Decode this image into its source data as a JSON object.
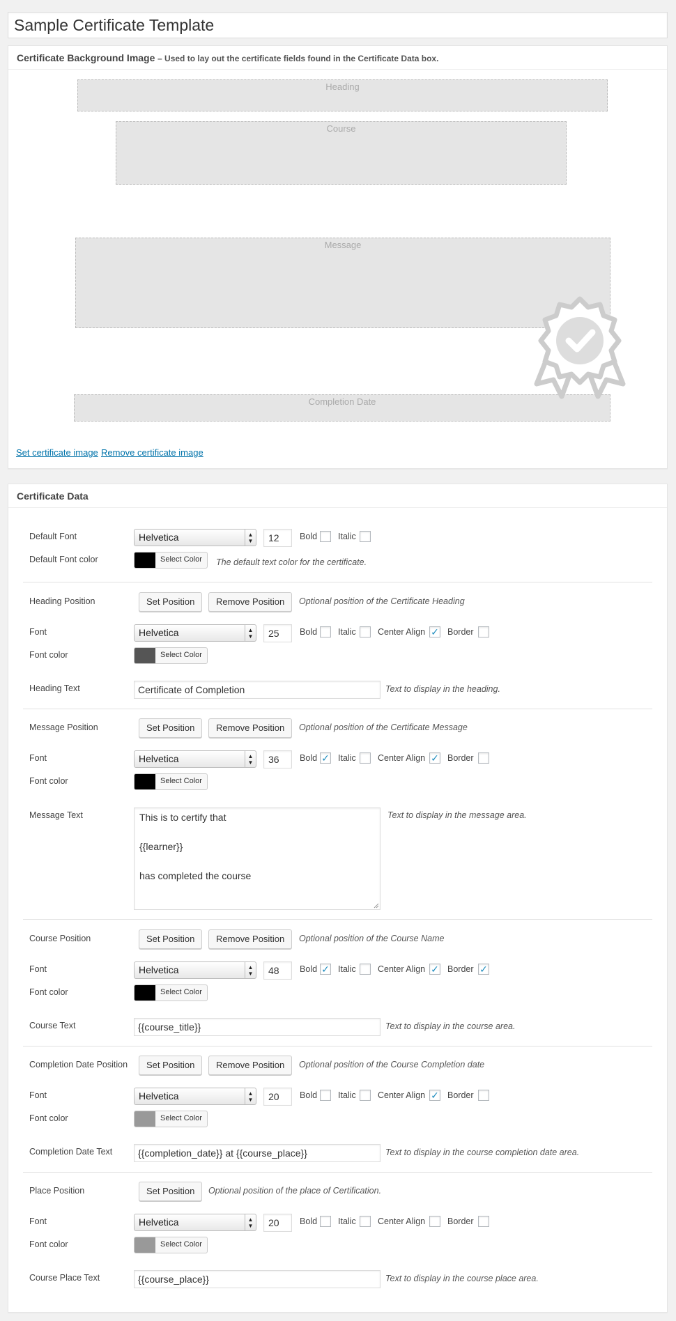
{
  "page_title": "Sample Certificate Template",
  "background_box": {
    "title": "Certificate Background Image",
    "subtitle": "– Used to lay out the certificate fields found in the Certificate Data box.",
    "fields": {
      "heading": "Heading",
      "course": "Course",
      "message": "Message",
      "completion_date": "Completion Date"
    },
    "set_link": "Set certificate image",
    "remove_link": "Remove certificate image"
  },
  "data_box": {
    "title": "Certificate Data",
    "labels": {
      "select_color": "Select Color",
      "bold": "Bold",
      "italic": "Italic",
      "center_align": "Center Align",
      "border": "Border",
      "set_position": "Set Position",
      "remove_position": "Remove Position",
      "font": "Font",
      "font_color": "Font color"
    },
    "default": {
      "font_label": "Default Font",
      "font": "Helvetica",
      "size": "12",
      "color_label": "Default Font color",
      "color": "#000000",
      "desc": "The default text color for the certificate.",
      "bold": false,
      "italic": false
    },
    "heading": {
      "position_label": "Heading Position",
      "position_desc": "Optional position of the Certificate Heading",
      "font": "Helvetica",
      "size": "25",
      "color": "#555555",
      "bold": false,
      "italic": false,
      "center": true,
      "border": false,
      "text_label": "Heading Text",
      "text": "Certificate of Completion",
      "text_desc": "Text to display in the heading."
    },
    "message": {
      "position_label": "Message Position",
      "position_desc": "Optional position of the Certificate Message",
      "font": "Helvetica",
      "size": "36",
      "color": "#000000",
      "bold": true,
      "italic": false,
      "center": true,
      "border": false,
      "text_label": "Message Text",
      "text_lines": [
        "This is to certify that",
        "{{learner}}",
        "has completed the course"
      ],
      "text_desc": "Text to display in the message area."
    },
    "course": {
      "position_label": "Course Position",
      "position_desc": "Optional position of the Course Name",
      "font": "Helvetica",
      "size": "48",
      "color": "#000000",
      "bold": true,
      "italic": false,
      "center": true,
      "border": true,
      "text_label": "Course Text",
      "text": "{{course_title}}",
      "text_desc": "Text to display in the course area."
    },
    "completion": {
      "position_label": "Completion Date Position",
      "position_desc": "Optional position of the Course Completion date",
      "font": "Helvetica",
      "size": "20",
      "color": "#999999",
      "bold": false,
      "italic": false,
      "center": true,
      "border": false,
      "text_label": "Completion Date Text",
      "text": "{{completion_date}} at {{course_place}}",
      "text_desc": "Text to display in the course completion date area."
    },
    "place": {
      "position_label": "Place Position",
      "position_desc": "Optional position of the place of Certification.",
      "font": "Helvetica",
      "size": "20",
      "color": "#999999",
      "bold": false,
      "italic": false,
      "center": false,
      "border": false,
      "text_label": "Course Place Text",
      "text": "{{course_place}}",
      "text_desc": "Text to display in the course place area."
    }
  }
}
